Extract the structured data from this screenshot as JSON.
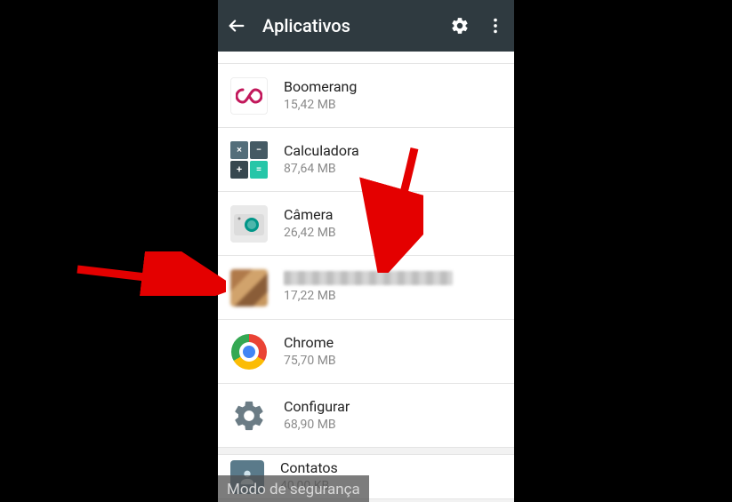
{
  "toolbar": {
    "title": "Aplicativos"
  },
  "apps": [
    {
      "name": "Boomerang",
      "size": "15,42 MB"
    },
    {
      "name": "Calculadora",
      "size": "87,64 MB"
    },
    {
      "name": "Câmera",
      "size": "26,42 MB"
    },
    {
      "name": "",
      "size": "17,22 MB",
      "censored": true
    },
    {
      "name": "Chrome",
      "size": "75,70 MB"
    },
    {
      "name": "Configurar",
      "size": "68,90 MB"
    },
    {
      "name": "Contatos",
      "size": "40,00 KB"
    }
  ],
  "overlay": {
    "safe_mode": "Modo de segurança"
  }
}
